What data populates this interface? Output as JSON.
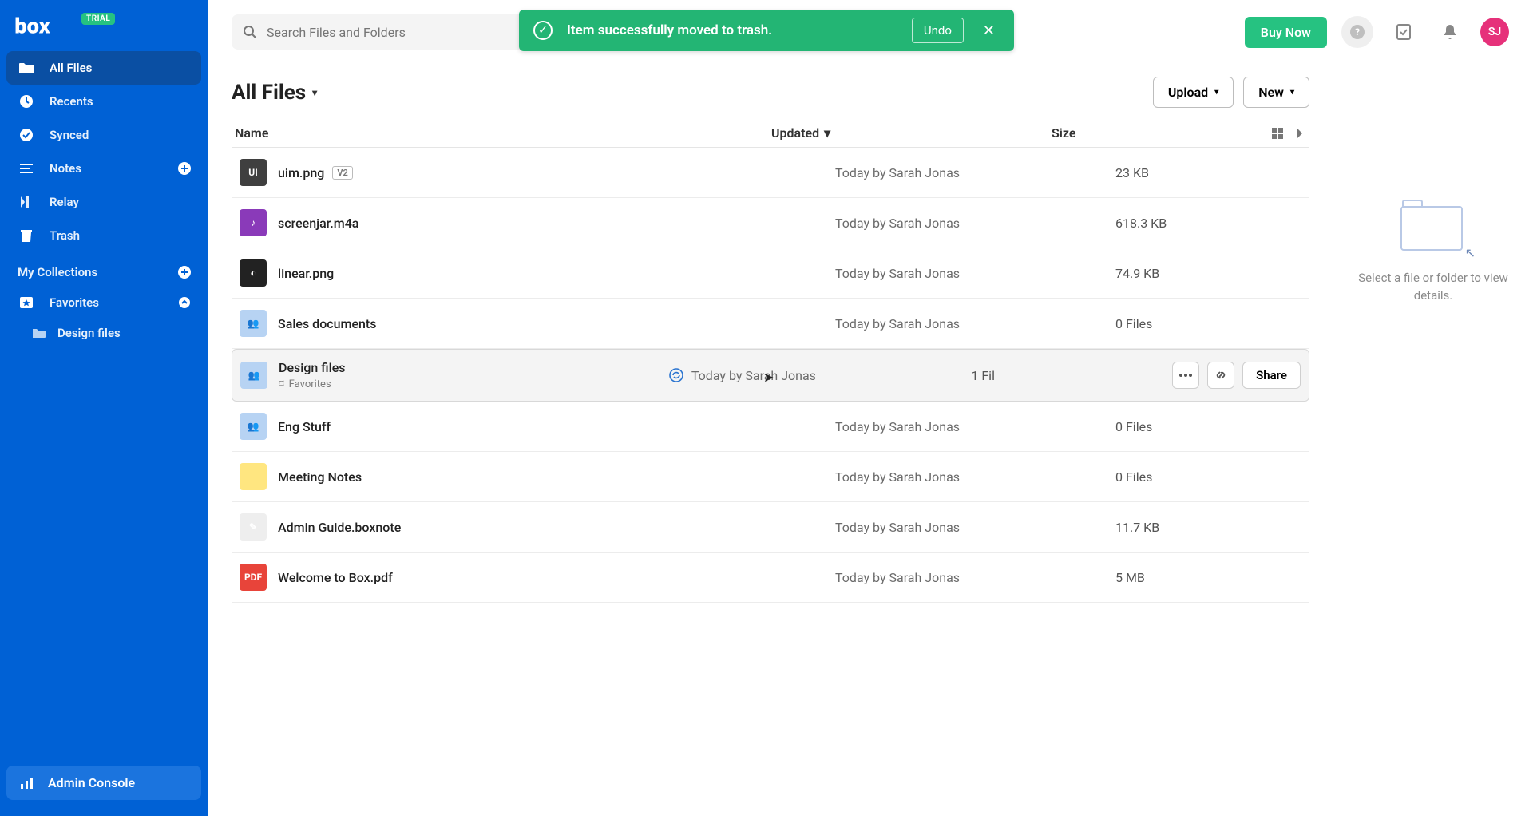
{
  "brand": {
    "name": "box",
    "trial_badge": "TRIAL"
  },
  "sidebar": {
    "all_files": "All Files",
    "recents": "Recents",
    "synced": "Synced",
    "notes": "Notes",
    "relay": "Relay",
    "trash": "Trash",
    "collections_title": "My Collections",
    "favorites": "Favorites",
    "fav_items": [
      "Design files"
    ],
    "admin_console": "Admin Console"
  },
  "search": {
    "placeholder": "Search Files and Folders"
  },
  "header": {
    "buy_now": "Buy Now",
    "avatar_initials": "SJ"
  },
  "toast": {
    "message": "Item successfully moved to trash.",
    "undo": "Undo"
  },
  "page_title": "All Files",
  "actions": {
    "upload": "Upload",
    "new": "New"
  },
  "columns": {
    "name": "Name",
    "updated": "Updated",
    "size": "Size"
  },
  "rows": [
    {
      "icon": "fi-dark",
      "label": "UI",
      "name": "uim.png",
      "badge": "V2",
      "updated": "Today by Sarah Jonas",
      "size": "23 KB"
    },
    {
      "icon": "fi-purple",
      "label": "♪",
      "name": "screenjar.m4a",
      "updated": "Today by Sarah Jonas",
      "size": "618.3 KB"
    },
    {
      "icon": "fi-black",
      "label": "◐",
      "name": "linear.png",
      "updated": "Today by Sarah Jonas",
      "size": "74.9 KB"
    },
    {
      "icon": "fi-bluefolder",
      "label": "👥",
      "name": "Sales documents",
      "updated": "Today by Sarah Jonas",
      "size": "0 Files"
    },
    {
      "icon": "fi-bluefolder",
      "label": "👥",
      "name": "Design files",
      "favorite": "Favorites",
      "synced": true,
      "updated": "Today by Sarah Jonas",
      "size": "1 Fil",
      "hovered": true
    },
    {
      "icon": "fi-bluefolder",
      "label": "👥",
      "name": "Eng Stuff",
      "updated": "Today by Sarah Jonas",
      "size": "0 Files"
    },
    {
      "icon": "fi-yellowfolder",
      "label": "",
      "name": "Meeting Notes",
      "updated": "Today by Sarah Jonas",
      "size": "0 Files"
    },
    {
      "icon": "fi-note",
      "label": "✎",
      "name": "Admin Guide.boxnote",
      "updated": "Today by Sarah Jonas",
      "size": "11.7 KB"
    },
    {
      "icon": "fi-pdf",
      "label": "PDF",
      "name": "Welcome to Box.pdf",
      "updated": "Today by Sarah Jonas",
      "size": "5 MB"
    }
  ],
  "hover_actions": {
    "share": "Share"
  },
  "details_hint": "Select a file or folder to view details."
}
